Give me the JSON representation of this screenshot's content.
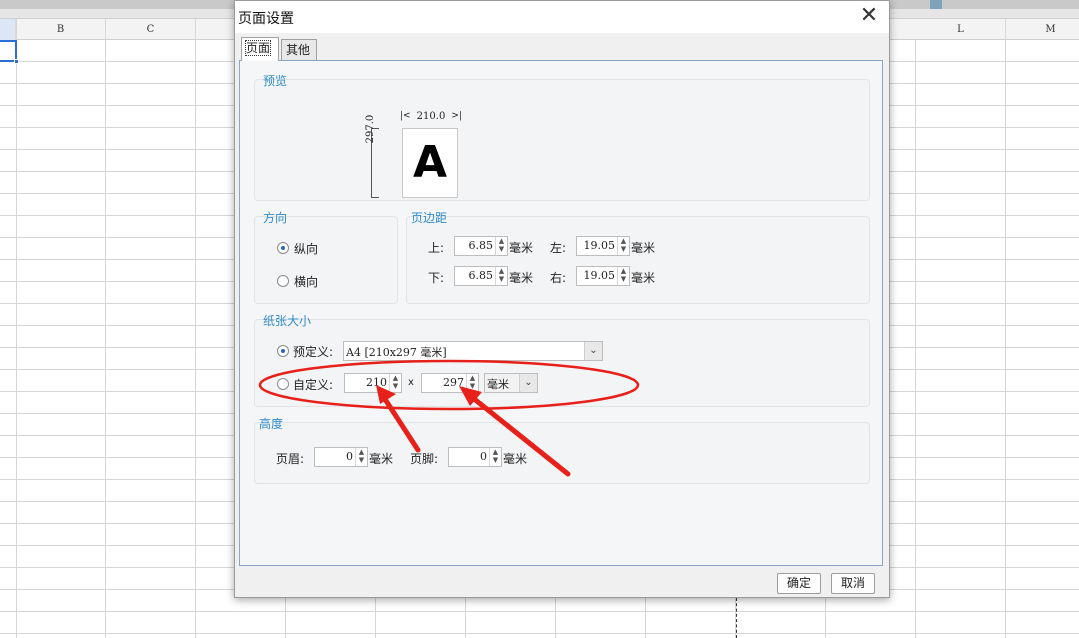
{
  "spreadsheet": {
    "columns": [
      "B",
      "C",
      "L",
      "M"
    ]
  },
  "dialog": {
    "title": "页面设置",
    "close_glyph": "✕",
    "tabs": [
      {
        "label": "页面"
      },
      {
        "label": "其他"
      }
    ],
    "preview": {
      "group_title": "预览",
      "width_label": "210.0",
      "height_label": "297.0",
      "sample_letter": "A"
    },
    "orientation": {
      "group_title": "方向",
      "portrait": "纵向",
      "landscape": "横向",
      "selected": "portrait"
    },
    "margins": {
      "group_title": "页边距",
      "top_label": "上:",
      "top_value": "6.85",
      "left_label": "左:",
      "left_value": "19.05",
      "bottom_label": "下:",
      "bottom_value": "6.85",
      "right_label": "右:",
      "right_value": "19.05",
      "unit": "毫米"
    },
    "paper_size": {
      "group_title": "纸张大小",
      "predefined_label": "预定义:",
      "predefined_value": "A4 [210x297 毫米]",
      "custom_label": "自定义:",
      "custom_width": "210",
      "times": "x",
      "custom_height": "297",
      "custom_unit": "毫米",
      "selected": "predefined"
    },
    "height": {
      "group_title": "高度",
      "header_label": "页眉:",
      "header_value": "0",
      "footer_label": "页脚:",
      "footer_value": "0",
      "unit": "毫米"
    },
    "ok_label": "确定",
    "cancel_label": "取消"
  },
  "annotation_color": "#e8201a",
  "accent_color": "#2f8bc9"
}
